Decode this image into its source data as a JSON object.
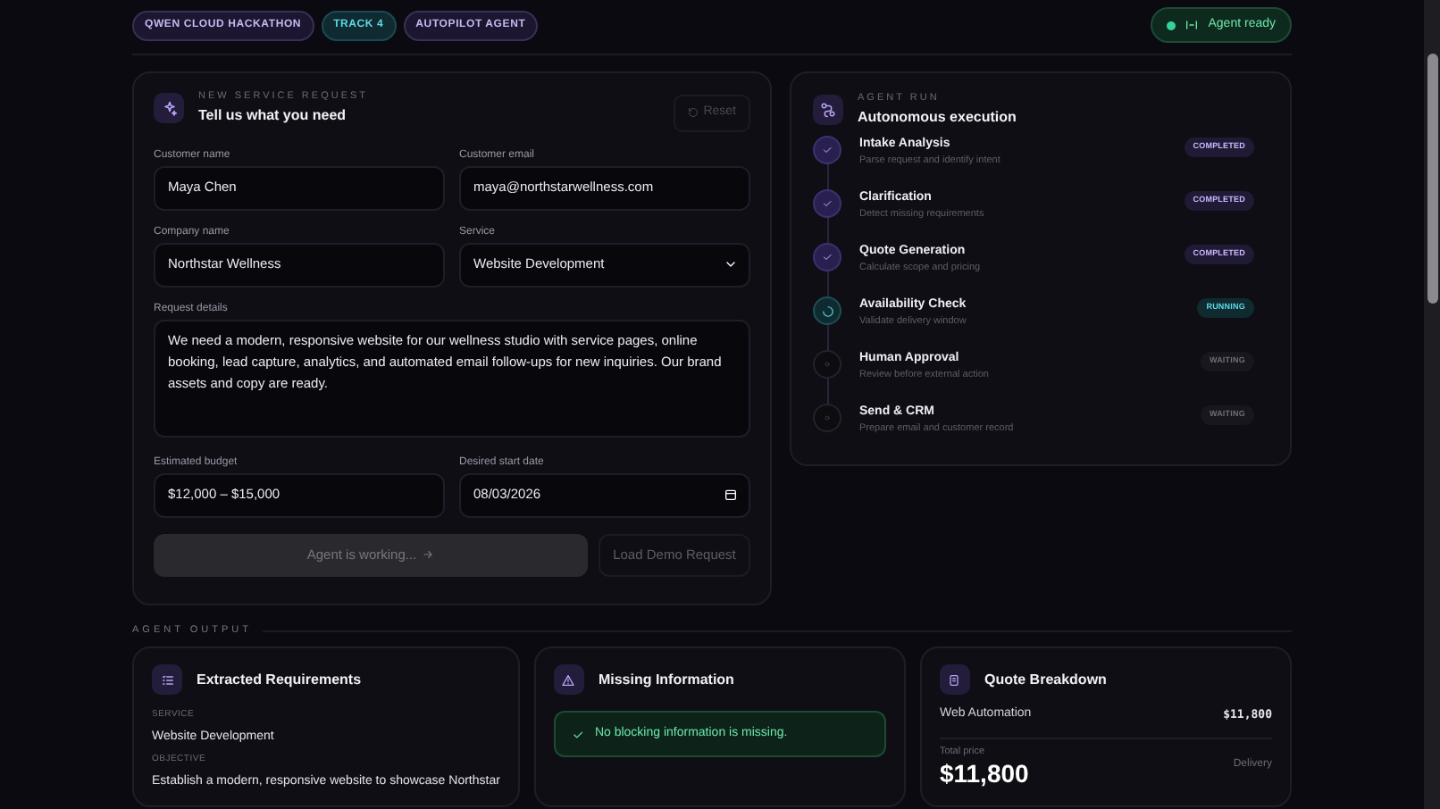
{
  "tags": [
    {
      "label": "QWEN CLOUD HACKATHON",
      "kind": "violet"
    },
    {
      "label": "TRACK 4",
      "kind": "cyan"
    },
    {
      "label": "AUTOPILOT AGENT",
      "kind": "violet"
    }
  ],
  "agent_status": {
    "label": "Agent ready",
    "on": true
  },
  "request_card": {
    "eyebrow": "NEW SERVICE REQUEST",
    "title": "Tell us what you need",
    "reset": "Reset",
    "fields": [
      {
        "label": "Customer name",
        "value": "Maya Chen",
        "kind": "text"
      },
      {
        "label": "Customer email",
        "value": "maya@northstarwellness.com",
        "kind": "text"
      },
      {
        "label": "Company name",
        "value": "Northstar Wellness",
        "kind": "text"
      },
      {
        "label": "Service",
        "value": "Website Development",
        "kind": "select"
      }
    ],
    "details": {
      "label": "Request details",
      "value": "We need a modern, responsive website for our wellness studio with service pages, online booking, lead capture, analytics, and automated email follow-ups for new inquiries. Our brand assets and copy are ready."
    },
    "fields_2": [
      {
        "label": "Estimated budget",
        "value": "$12,000 – $15,000",
        "kind": "text"
      },
      {
        "label": "Desired start date",
        "value": "08/03/2026",
        "kind": "date"
      }
    ],
    "submit": {
      "label": "Agent is working...",
      "disabled": true
    },
    "demo": "Load Demo Request"
  },
  "run_card": {
    "eyebrow": "AGENT RUN",
    "title": "Autonomous execution",
    "steps": [
      {
        "title": "Intake Analysis",
        "subtitle": "Parse request and identify intent",
        "status": "COMPLETED",
        "kind": "completed"
      },
      {
        "title": "Clarification",
        "subtitle": "Detect missing requirements",
        "status": "COMPLETED",
        "kind": "completed"
      },
      {
        "title": "Quote Generation",
        "subtitle": "Calculate scope and pricing",
        "status": "COMPLETED",
        "kind": "completed"
      },
      {
        "title": "Availability Check",
        "subtitle": "Validate delivery window",
        "status": "RUNNING",
        "kind": "running"
      },
      {
        "title": "Human Approval",
        "subtitle": "Review before external action",
        "status": "WAITING",
        "kind": "waiting"
      },
      {
        "title": "Send & CRM",
        "subtitle": "Prepare email and customer record",
        "status": "WAITING",
        "kind": "waiting"
      }
    ]
  },
  "output": {
    "heading": "AGENT OUTPUT",
    "requirements": {
      "title": "Extracted Requirements",
      "items": [
        {
          "label": "SERVICE",
          "value": "Website Development"
        },
        {
          "label": "OBJECTIVE",
          "value": "Establish a modern, responsive website to showcase Northstar"
        }
      ]
    },
    "missing": {
      "title": "Missing Information",
      "message": "No blocking information is missing."
    },
    "quote": {
      "title": "Quote Breakdown",
      "lines": [
        {
          "name": "Web Automation",
          "amount": "$11,800"
        }
      ],
      "total_label": "Total price",
      "total": "$11,800",
      "delivery_label": "Delivery"
    }
  }
}
